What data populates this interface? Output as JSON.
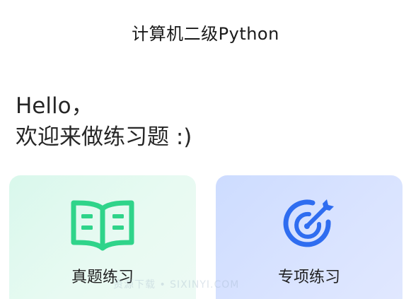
{
  "header": {
    "title": "计算机二级Python"
  },
  "greeting": {
    "line1": "Hello，",
    "line2": "欢迎来做练习题 :)"
  },
  "cards": [
    {
      "label": "真题练习",
      "icon": "book-icon",
      "color": "#2fd48a"
    },
    {
      "label": "专项练习",
      "icon": "target-icon",
      "color": "#2f6df0"
    }
  ],
  "watermark": "资源下载 • SIXINYI.COM"
}
